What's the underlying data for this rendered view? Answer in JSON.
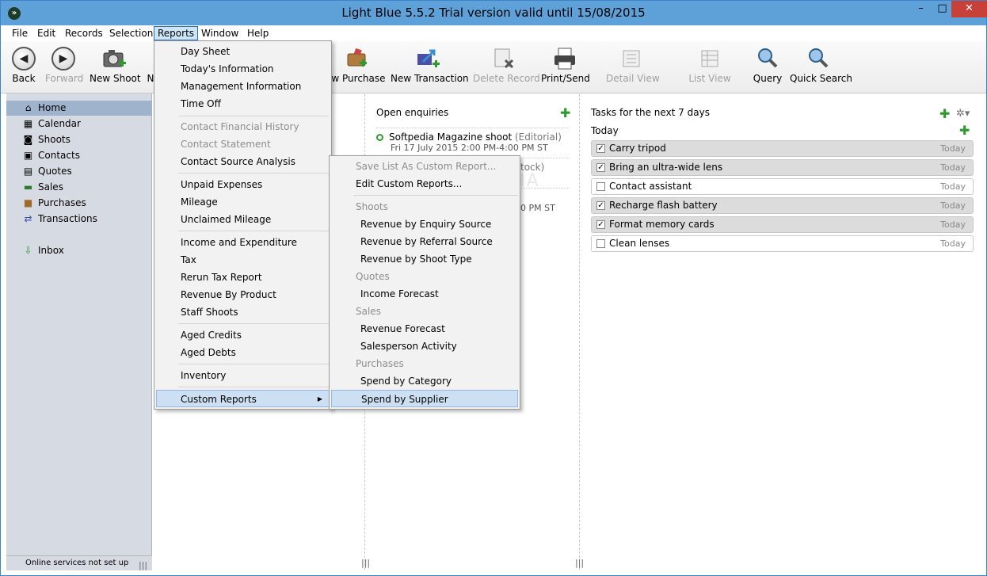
{
  "window": {
    "title": "Light Blue 5.5.2   Trial version valid until 15/08/2015",
    "min": "–",
    "max": "□",
    "close": "✕",
    "app_icon": "»"
  },
  "menubar": [
    "File",
    "Edit",
    "Records",
    "Selection",
    "Reports",
    "Window",
    "Help"
  ],
  "toolbar": {
    "back": "Back",
    "forward": "Forward",
    "new_shoot": "New Shoot",
    "new_obscured": "N",
    "new_purchase": "ew Purchase",
    "new_transaction": "New Transaction",
    "delete_record": "Delete Record",
    "print_send": "Print/Send",
    "detail_view": "Detail View",
    "list_view": "List View",
    "query": "Query",
    "quick_search": "Quick Search"
  },
  "sidebar": {
    "items": [
      {
        "label": "Home",
        "icon": "home-icon"
      },
      {
        "label": "Calendar",
        "icon": "calendar-icon"
      },
      {
        "label": "Shoots",
        "icon": "shoots-icon"
      },
      {
        "label": "Contacts",
        "icon": "contacts-icon"
      },
      {
        "label": "Quotes",
        "icon": "quotes-icon"
      },
      {
        "label": "Sales",
        "icon": "sales-icon"
      },
      {
        "label": "Purchases",
        "icon": "purchases-icon"
      },
      {
        "label": "Transactions",
        "icon": "transactions-icon"
      },
      {
        "label": "Inbox",
        "icon": "inbox-icon"
      }
    ],
    "status": "Online services not set up"
  },
  "enquiries": {
    "title": "Open enquiries",
    "items": [
      {
        "title": "Softpedia Magazine shoot",
        "tag": "(Editorial)",
        "sub": "Fri 17 July 2015 2:00 PM-4:00 PM ST"
      },
      {
        "tail_title": "tock)",
        "tail_sub": "0 PM ST"
      }
    ]
  },
  "tasks": {
    "title": "Tasks for the next 7 days",
    "section": "Today",
    "items": [
      {
        "label": "Carry tripod",
        "date": "Today",
        "done": true
      },
      {
        "label": "Bring an ultra-wide lens",
        "date": "Today",
        "done": true
      },
      {
        "label": "Contact assistant",
        "date": "Today",
        "done": false
      },
      {
        "label": "Recharge flash battery",
        "date": "Today",
        "done": true
      },
      {
        "label": "Format memory cards",
        "date": "Today",
        "done": true
      },
      {
        "label": "Clean lenses",
        "date": "Today",
        "done": false
      }
    ]
  },
  "reports_menu": [
    "Day Sheet",
    "Today's Information",
    "Management Information",
    "Time Off",
    "Contact Financial History",
    "Contact Statement",
    "Contact Source Analysis",
    "Unpaid Expenses",
    "Mileage",
    "Unclaimed Mileage",
    "Income and Expenditure",
    "Tax",
    "Rerun Tax Report",
    "Revenue By Product",
    "Staff Shoots",
    "Aged Credits",
    "Aged Debts",
    "Inventory",
    "Custom Reports"
  ],
  "custom_reports_menu": {
    "save_list": "Save List As Custom Report...",
    "edit": "Edit Custom Reports...",
    "shoots_header": "Shoots",
    "rev_enquiry": "Revenue by Enquiry Source",
    "rev_referral": "Revenue by Referral Source",
    "rev_shoot_type": "Revenue by Shoot Type",
    "quotes_header": "Quotes",
    "income_forecast": "Income Forecast",
    "sales_header": "Sales",
    "revenue_forecast": "Revenue Forecast",
    "salesperson": "Salesperson Activity",
    "purchases_header": "Purchases",
    "spend_category": "Spend by Category",
    "spend_supplier": "Spend by Supplier"
  },
  "watermark": "SOFTPEDIA",
  "submenu_arrow": "▶",
  "colors": {
    "accent": "#5ea0d8",
    "green_plus": "#2d9a2d",
    "sidebar": "#d6dbe3"
  }
}
